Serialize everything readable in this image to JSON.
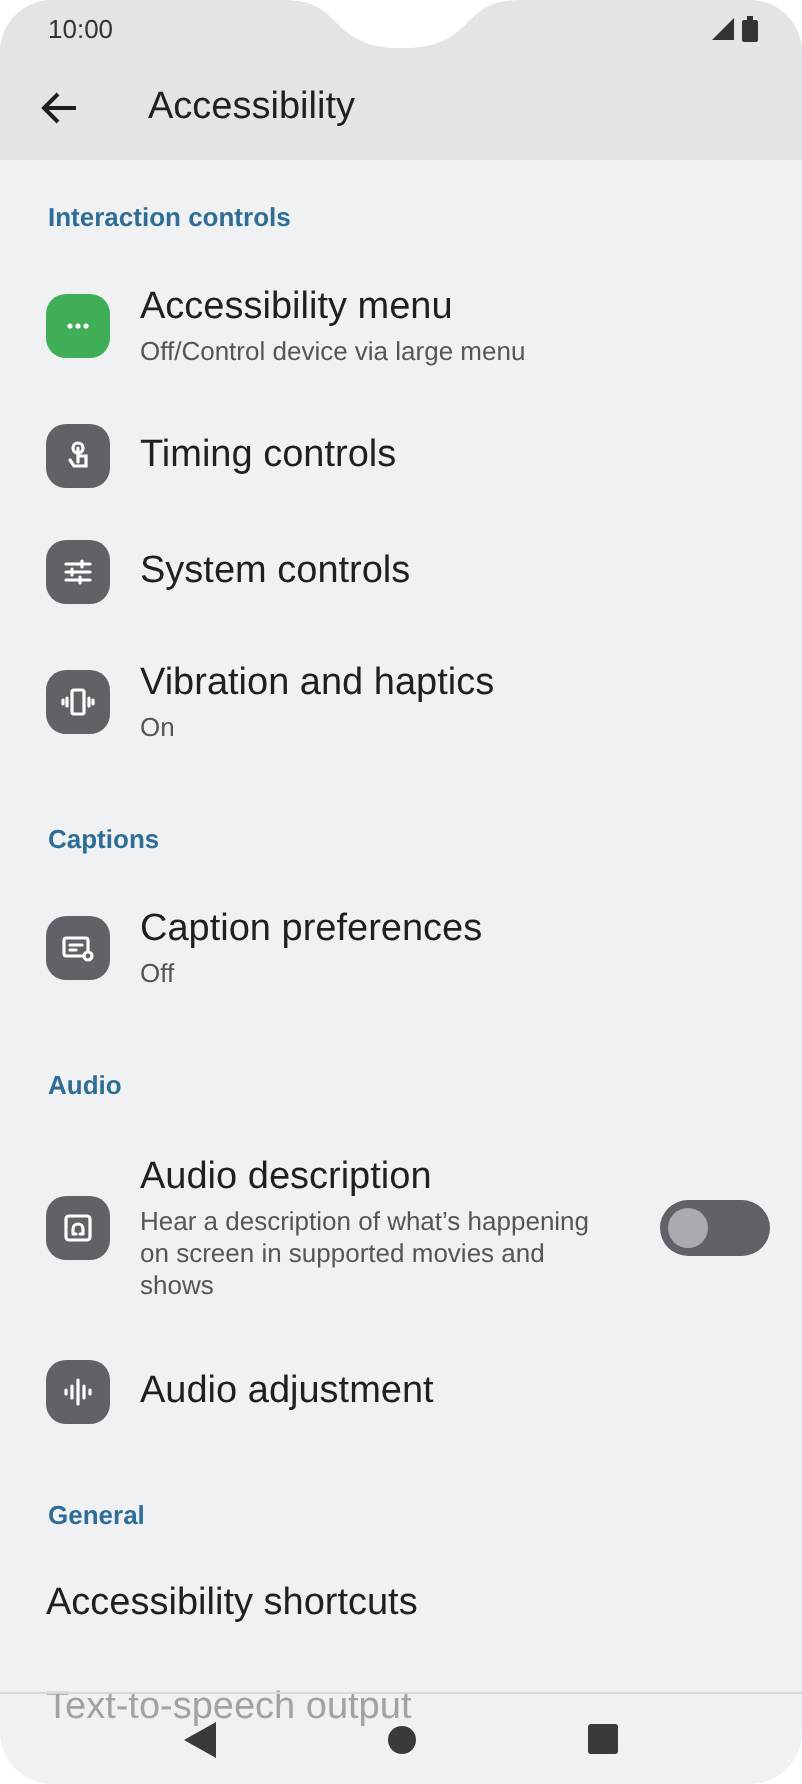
{
  "status_bar": {
    "time": "10:00"
  },
  "app_bar": {
    "title": "Accessibility"
  },
  "sections": [
    {
      "title": "Interaction controls",
      "items": [
        {
          "kind": "icon",
          "title": "Accessibility menu",
          "subtitle": "Off/Control device via large menu",
          "color": "#3fae57"
        },
        {
          "kind": "icon",
          "title": "Timing controls",
          "color": "#5f6368"
        },
        {
          "kind": "icon",
          "title": "System controls",
          "color": "#5f6368"
        },
        {
          "kind": "icon",
          "title": "Vibration and haptics",
          "subtitle": "On",
          "color": "#5f6368"
        }
      ]
    },
    {
      "title": "Captions",
      "items": [
        {
          "kind": "icon",
          "title": "Caption preferences",
          "subtitle": "Off",
          "color": "#5f6368"
        }
      ]
    },
    {
      "title": "Audio",
      "items": [
        {
          "kind": "switch",
          "title": "Audio description",
          "subtitle": "Hear a description of what’s happening on screen in supported movies and shows",
          "color": "#5f6368",
          "on": false
        },
        {
          "kind": "icon",
          "title": "Audio adjustment",
          "color": "#5f6368"
        }
      ]
    },
    {
      "title": "General",
      "items": [
        {
          "kind": "plain",
          "title": "Accessibility shortcuts"
        },
        {
          "kind": "plain",
          "title": "Text-to-speech output"
        }
      ]
    }
  ]
}
